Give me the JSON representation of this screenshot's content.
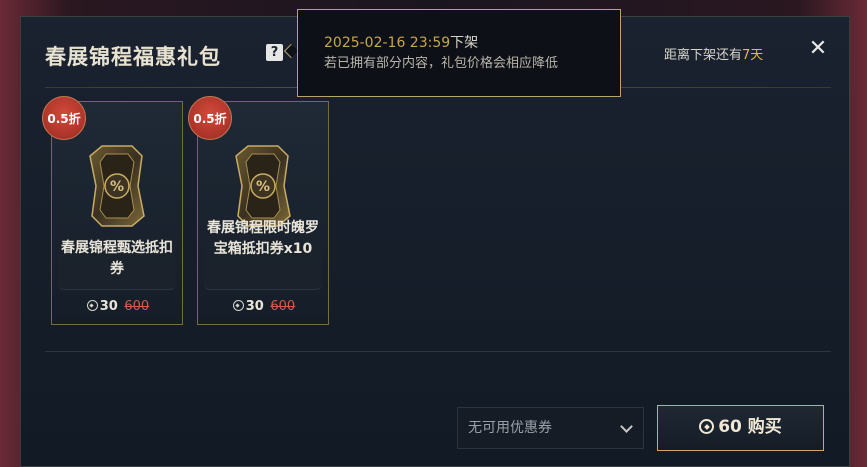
{
  "header": {
    "title": "春展锦程福惠礼包",
    "help_icon": "question-mark-icon",
    "countdown_prefix": "距离下架还有",
    "countdown_value": "7天",
    "close_icon": "✕"
  },
  "tooltip": {
    "date": "2025-02-16 23:59",
    "date_suffix": "下架",
    "note": "若已拥有部分内容，礼包价格会相应降低"
  },
  "items": [
    {
      "badge": "0.5折",
      "name": "春展锦程甄选抵扣券",
      "price": "30",
      "original_price": "600"
    },
    {
      "badge": "0.5折",
      "name": "春展锦程限时魄罗宝箱抵扣券x10",
      "price": "30",
      "original_price": "600"
    }
  ],
  "footer": {
    "coupon_placeholder": "无可用优惠券",
    "buy_price": "60",
    "buy_label": "购买"
  },
  "colors": {
    "accent_gold": "#c9ab63",
    "highlight": "#e9b93c",
    "discount_red": "#d24a3a"
  }
}
